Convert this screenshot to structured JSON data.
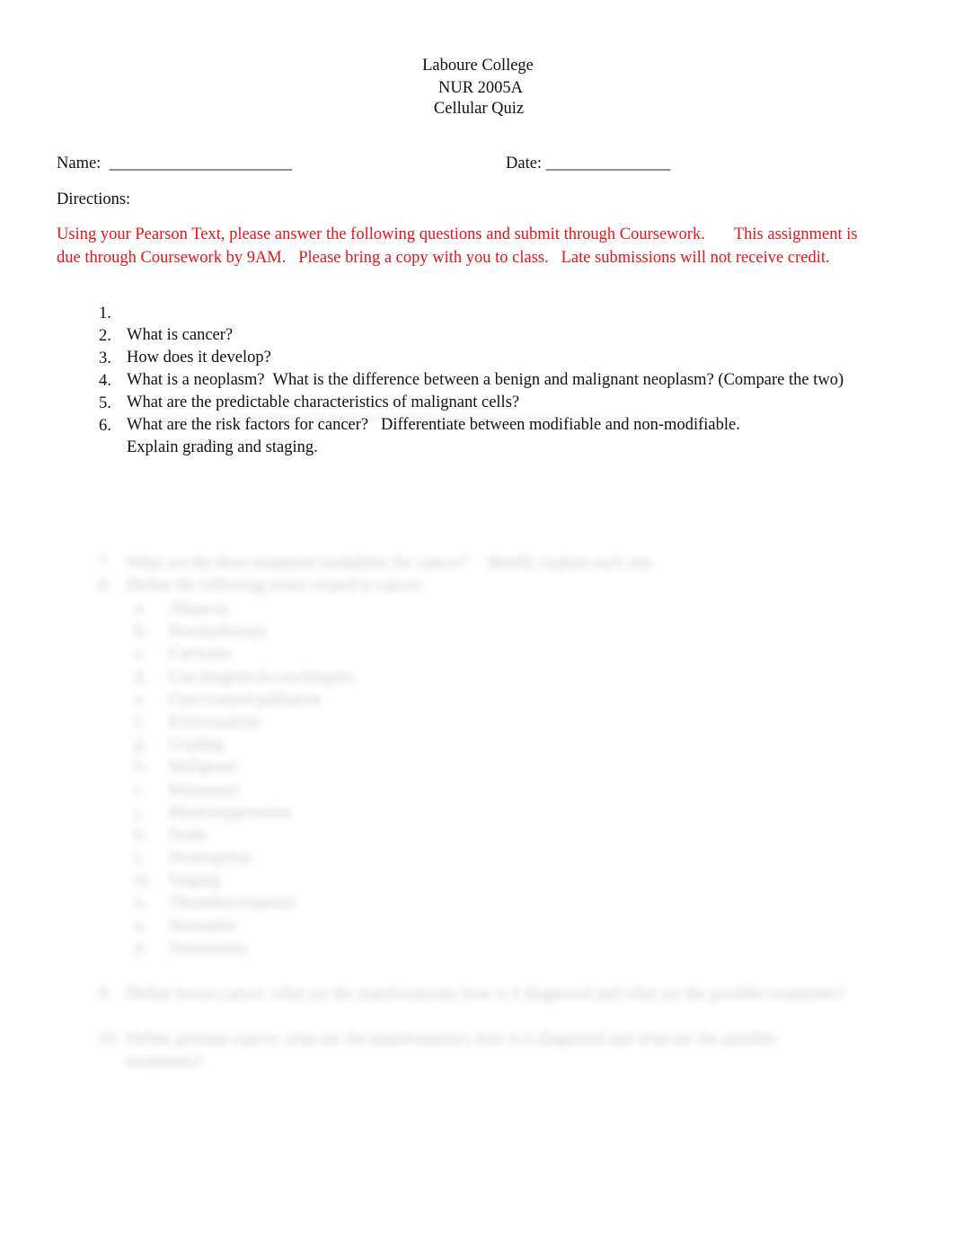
{
  "document": {
    "header": {
      "institution": "Laboure College",
      "course": "NUR 2005A",
      "title": "Cellular Quiz"
    },
    "fields": {
      "name_label": "Name:  ______________________",
      "date_label": "Date: _______________"
    },
    "directions_label": "Directions:",
    "instructions": {
      "color": "#e8141a",
      "line1": "Using your Pearson Text, please answer the following questions and submit through Coursework.       This assignment is",
      "line2": "due through Coursework by 9AM.   Please bring a copy with you to class.   Late submissions will not receive credit."
    },
    "questions": [
      {
        "num": "1.",
        "text": "What is cancer?"
      },
      {
        "num": "2.",
        "text": "How does it develop?"
      },
      {
        "num": "3.",
        "text": "What is a neoplasm?  What is the difference between a benign and malignant neoplasm? (Compare the two)"
      },
      {
        "num": "4.",
        "text": "What are the predictable characteristics of malignant cells?"
      },
      {
        "num": "5.",
        "text": "What are the risk factors for cancer?   Differentiate between modifiable and non-modifiable."
      },
      {
        "num": "6.",
        "text": "Explain grading and staging."
      }
    ],
    "obscured": {
      "q7": {
        "num": "7.",
        "text": "What are the three treatment modalities for cancer?     Briefly explain each one."
      },
      "q8": {
        "num": "8.",
        "text": "Define the following terms related to cancer:"
      },
      "sub_items": [
        {
          "num": "a.",
          "text": "Alopecia"
        },
        {
          "num": "b.",
          "text": "Brachytherapy"
        },
        {
          "num": "c.",
          "text": "Cachexia"
        },
        {
          "num": "d.",
          "text": "Carcinogenesis/carcinogens"
        },
        {
          "num": "e.",
          "text": "Cure/control/palliation"
        },
        {
          "num": "f.",
          "text": "Extravasation"
        },
        {
          "num": "g.",
          "text": "Grading"
        },
        {
          "num": "h.",
          "text": "Malignant"
        },
        {
          "num": "i.",
          "text": "Metastasis"
        },
        {
          "num": "j.",
          "text": "Myelosuppression"
        },
        {
          "num": "k.",
          "text": "Nadir"
        },
        {
          "num": "l.",
          "text": "Neutropenia"
        },
        {
          "num": "m.",
          "text": "Staging"
        },
        {
          "num": "n.",
          "text": "Thrombocytopenia"
        },
        {
          "num": "o.",
          "text": "Stomatitis"
        },
        {
          "num": "p.",
          "text": "Xerostomia"
        }
      ],
      "q9": {
        "num": "9.",
        "text": "Define breast cancer; what are the manifestations; how is it diagnosed and what are the possible treatments?"
      },
      "q10": {
        "num": "10.",
        "text": "Define prostate cancer; what are the manifestations; how is it diagnosed and what are the possible",
        "text2": "treatments?"
      }
    }
  }
}
